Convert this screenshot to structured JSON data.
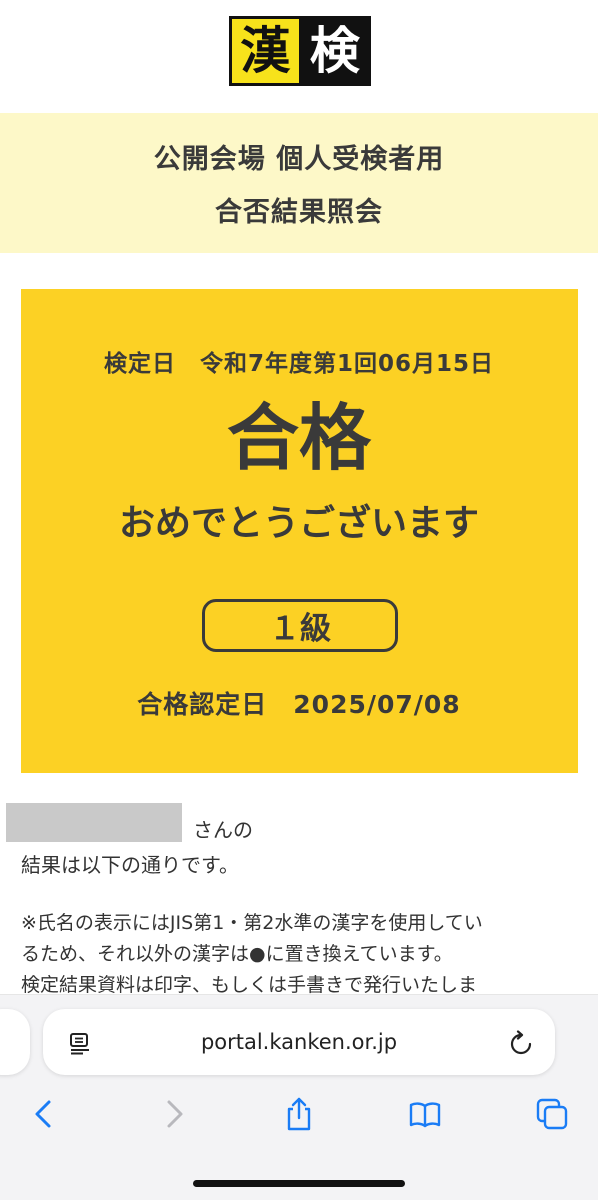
{
  "logo": {
    "char1": "漢",
    "char2": "検"
  },
  "header": {
    "title_line1": "公開会場 個人受検者用",
    "title_line2": "合否結果照会"
  },
  "result": {
    "exam_date": "検定日　令和7年度第1回06月15日",
    "status": "合格",
    "congrats": "おめでとうございます",
    "grade": "１級",
    "cert_date": "合格認定日　2025/07/08"
  },
  "body": {
    "honorific": "さんの",
    "result_text": "結果は以下の通りです。",
    "note_lines": [
      "※氏名の表示にはJIS第1・第2水準の漢字を使用してい",
      "るため、それ以外の漢字は●に置き換えています。",
      "検定結果資料は印字、もしくは手書きで発行いたしま"
    ]
  },
  "browser": {
    "url": "portal.kanken.or.jp",
    "icons": [
      "reader-icon",
      "reload-icon",
      "back-icon",
      "forward-icon",
      "share-icon",
      "bookmarks-icon",
      "tabs-icon"
    ]
  },
  "colors": {
    "result_yellow": "#fcd124",
    "title_band": "#fdf8c8",
    "logo_yellow": "#f7e21b",
    "ios_blue": "#1a7cf5"
  }
}
